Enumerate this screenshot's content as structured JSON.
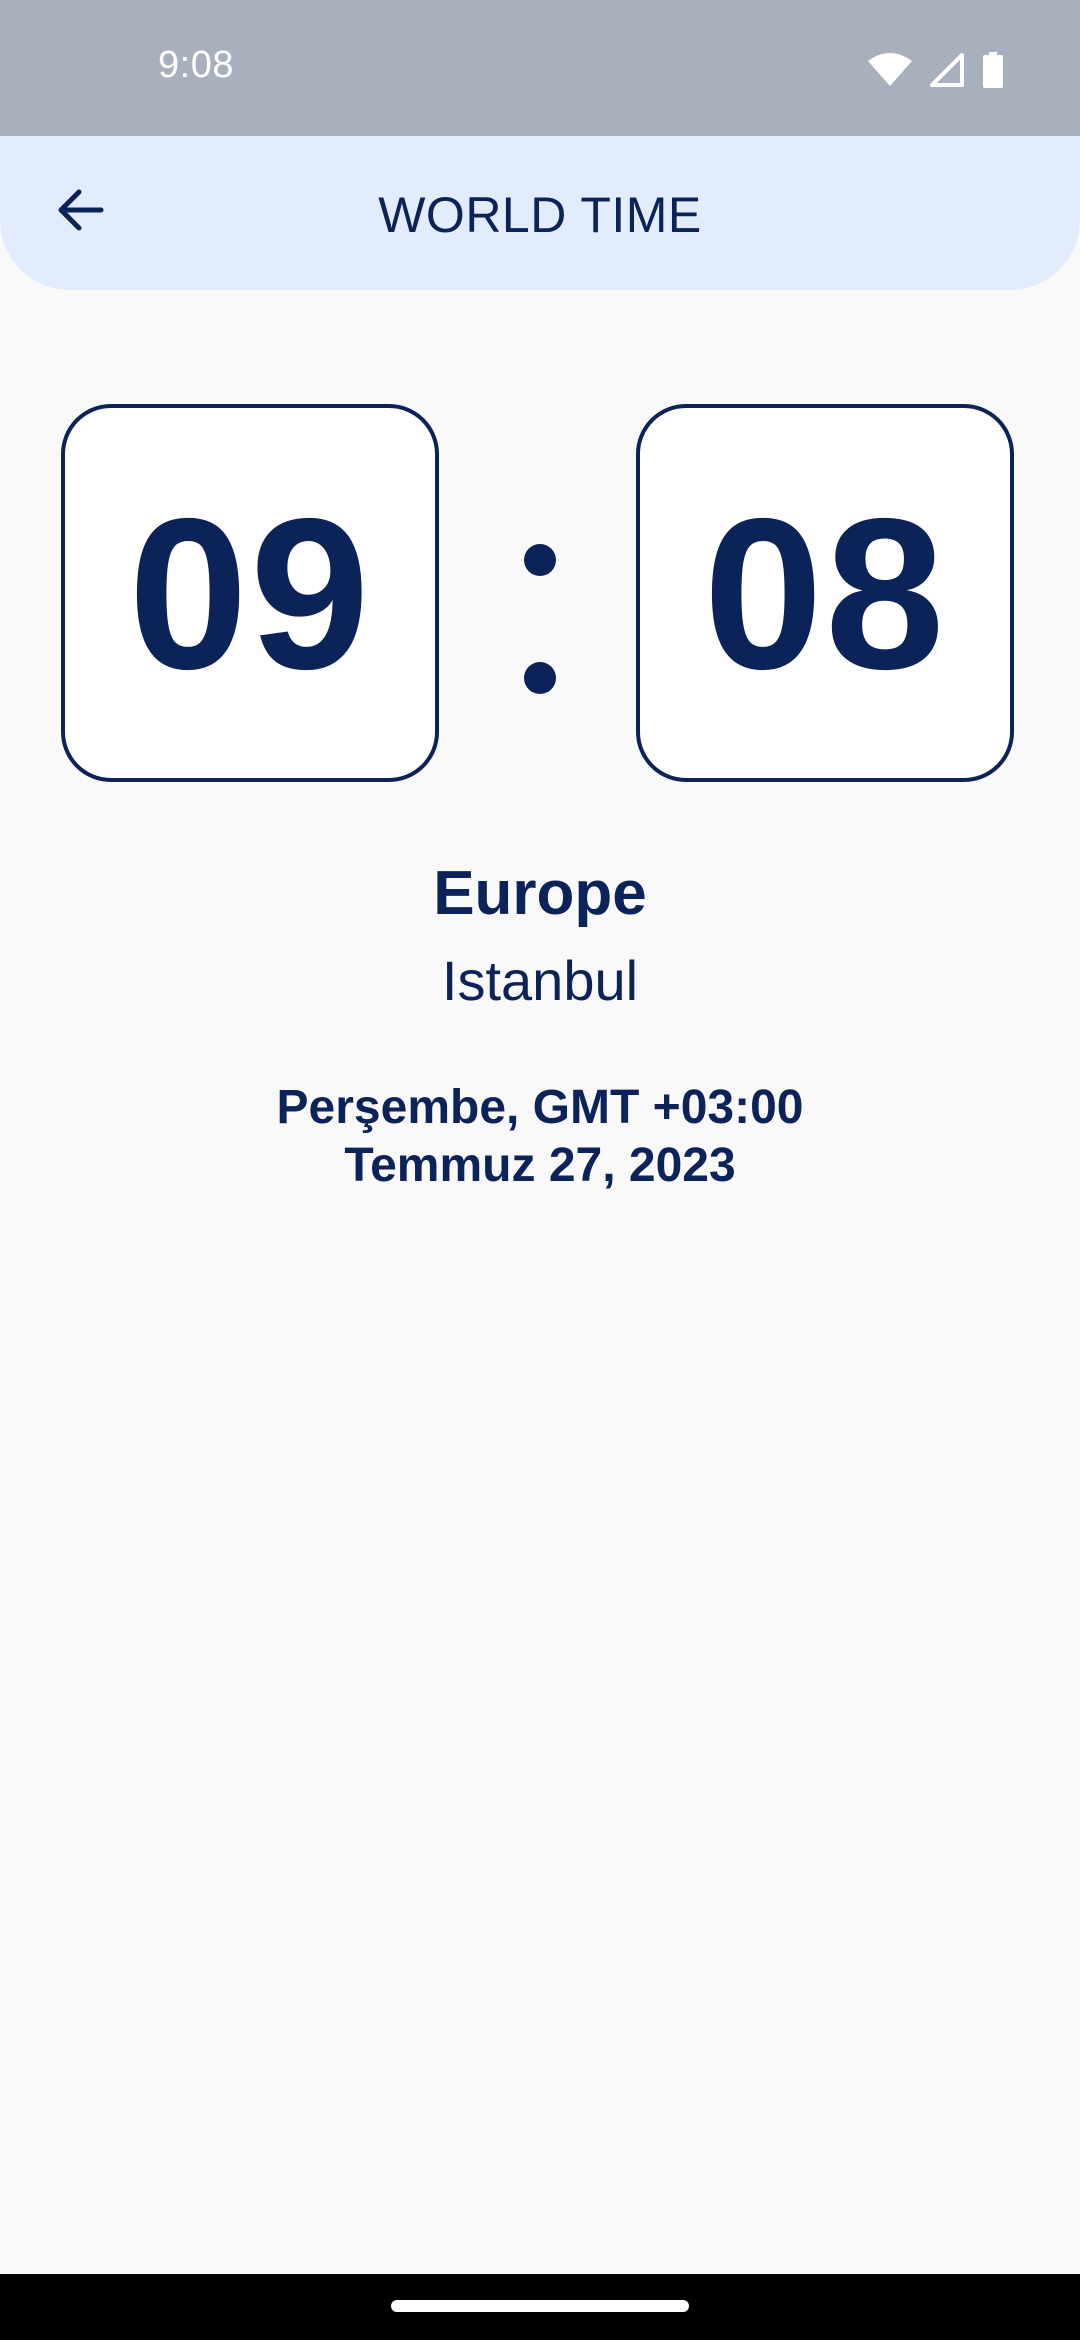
{
  "status_bar": {
    "time": "9:08",
    "icons": [
      "wifi-icon",
      "cellular-signal-icon",
      "battery-icon"
    ]
  },
  "app_bar": {
    "title": "WORLD TIME",
    "back_icon": "arrow-left-icon"
  },
  "clock": {
    "hours": "09",
    "minutes": "08"
  },
  "location": {
    "region": "Europe",
    "city": "Istanbul"
  },
  "details": {
    "day_gmt": "Perşembe, GMT +03:00",
    "date": "Temmuz 27, 2023"
  },
  "colors": {
    "primary": "#0b2358",
    "app_bar_bg": "#e2ecfc",
    "status_bar_bg": "#a9b0bd",
    "background": "#f9f9fa"
  }
}
